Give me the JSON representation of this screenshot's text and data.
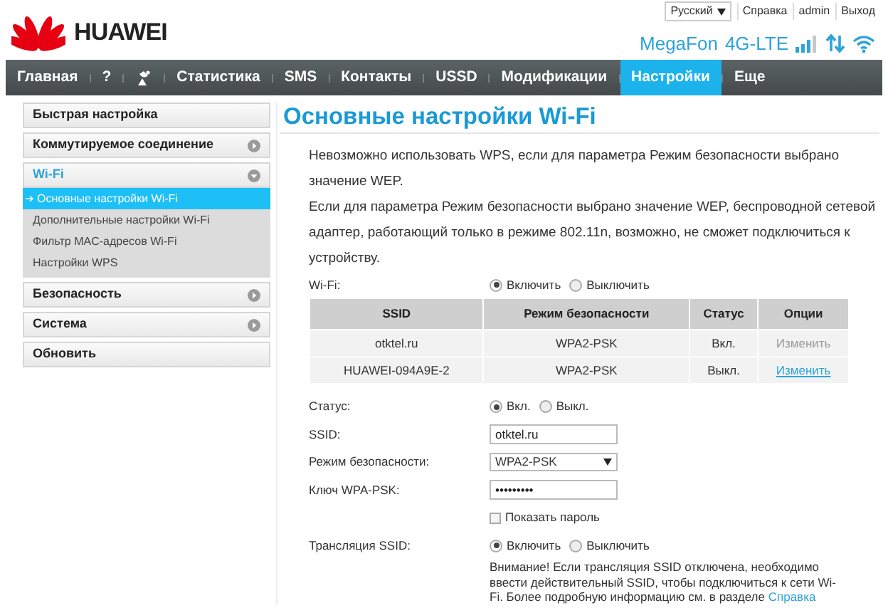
{
  "header": {
    "logo": "HUAWEI",
    "language": "Русский",
    "links": [
      "Справка",
      "admin",
      "Выход"
    ],
    "operator": "MegaFon",
    "network": "4G-LTE"
  },
  "nav": [
    {
      "kind": "text",
      "label": "Главная",
      "selected": false
    },
    {
      "kind": "text",
      "label": "?",
      "selected": false
    },
    {
      "kind": "icon",
      "selected": false
    },
    {
      "kind": "text",
      "label": "Статистика",
      "selected": false
    },
    {
      "kind": "text",
      "label": "SMS",
      "selected": false
    },
    {
      "kind": "text",
      "label": "Контакты",
      "selected": false
    },
    {
      "kind": "text",
      "label": "USSD",
      "selected": false
    },
    {
      "kind": "text",
      "label": "Модификации",
      "selected": false
    },
    {
      "kind": "text",
      "label": "Настройки",
      "selected": true
    },
    {
      "kind": "text",
      "label": "Еще",
      "selected": false
    }
  ],
  "sidebar": {
    "items": [
      {
        "kind": "plain",
        "label": "Быстрая настройка"
      },
      {
        "kind": "expandable",
        "label": "Коммутируемое соединение",
        "expanded": false
      },
      {
        "kind": "expandable",
        "label": "Wi-Fi",
        "expanded": true,
        "children": [
          {
            "label": "Основные настройки Wi-Fi",
            "selected": true
          },
          {
            "label": "Дополнительные настройки Wi-Fi",
            "selected": false
          },
          {
            "label": "Фильтр MAC-адресов Wi-Fi",
            "selected": false
          },
          {
            "label": "Настройки WPS",
            "selected": false
          }
        ]
      },
      {
        "kind": "expandable",
        "label": "Безопасность",
        "expanded": false
      },
      {
        "kind": "expandable",
        "label": "Система",
        "expanded": false
      },
      {
        "kind": "plain",
        "label": "Обновить"
      }
    ]
  },
  "content": {
    "title": "Основные настройки Wi-Fi",
    "notes": [
      "Невозможно использовать WPS, если для параметра Режим безопасности выбрано значение WEP.",
      "Если для параметра Режим безопасности выбрано значение WEP, беспроводной сетевой адаптер, работающий только в режиме 802.11n, возможно, не сможет подключиться к устройству."
    ],
    "wifi": {
      "label": "Wi-Fi:",
      "options": [
        {
          "label": "Включить",
          "selected": true
        },
        {
          "label": "Выключить",
          "selected": false
        }
      ]
    },
    "table": {
      "columns": [
        "SSID",
        "Режим безопасности",
        "Статус",
        "Опции"
      ],
      "rows": [
        {
          "cells": [
            "otktel.ru",
            "WPA2-PSK",
            "Вкл."
          ],
          "action": {
            "label": "Изменить",
            "disabled": true
          }
        },
        {
          "cells": [
            "HUAWEI-094A9E-2",
            "WPA2-PSK",
            "Выкл."
          ],
          "action": {
            "label": "Изменить",
            "disabled": false
          }
        }
      ]
    },
    "form": [
      {
        "kind": "radio",
        "label": "Статус:",
        "options": [
          {
            "label": "Вкл.",
            "selected": true
          },
          {
            "label": "Выкл.",
            "selected": false
          }
        ]
      },
      {
        "kind": "text",
        "label": "SSID:",
        "value": "otktel.ru"
      },
      {
        "kind": "select",
        "label": "Режим безопасности:",
        "value": "WPA2-PSK"
      },
      {
        "kind": "password",
        "label": "Ключ WPA-PSK:",
        "value": "•••••••••"
      },
      {
        "kind": "checkbox",
        "option": "Показать пароль",
        "checked": false
      },
      {
        "kind": "radio",
        "label": "Трансляция SSID:",
        "options": [
          {
            "label": "Включить",
            "selected": true
          },
          {
            "label": "Выключить",
            "selected": false
          }
        ]
      }
    ],
    "warning": {
      "text": "Внимание! Если трансляция SSID отключена, необходимо ввести действительный SSID, чтобы подключиться к сети Wi-Fi. Более подробную информацию см. в разделе",
      "link": "Справка"
    }
  }
}
